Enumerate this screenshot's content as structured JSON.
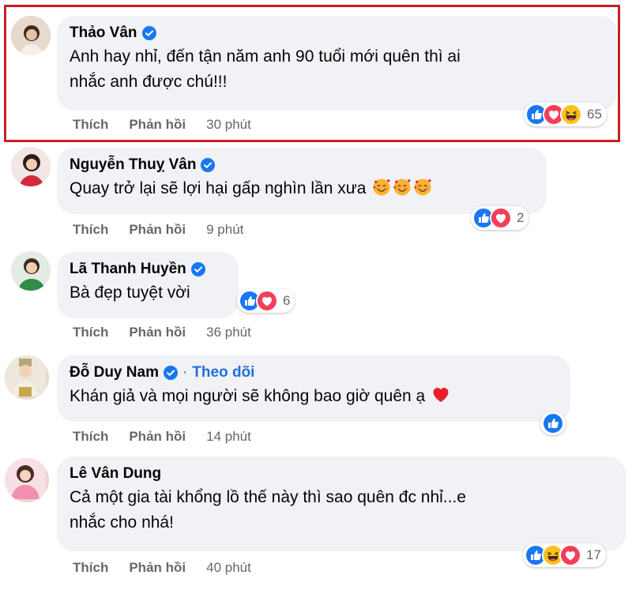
{
  "comments": [
    {
      "name": "Thảo Vân",
      "verified": true,
      "text_lines": [
        "Anh hay nhỉ, đến tận năm anh 90 tuổi mới quên thì ai",
        "nhắc anh được chú!!!"
      ],
      "reactions": [
        "like-icon",
        "love-icon",
        "haha-icon"
      ],
      "reaction_count": "65",
      "like_label": "Thích",
      "reply_label": "Phản hồi",
      "time": "30 phút",
      "highlighted": true
    },
    {
      "name": "Nguyễn Thuỵ Vân",
      "verified": true,
      "text": "Quay trở lại sẽ lợi hại gấp nghìn lần xưa",
      "text_emojis": [
        "smiling-face-with-hearts-icon",
        "smiling-face-with-hearts-icon",
        "smiling-face-with-hearts-icon"
      ],
      "reactions": [
        "like-icon",
        "love-icon"
      ],
      "reaction_count": "2",
      "like_label": "Thích",
      "reply_label": "Phản hồi",
      "time": "9 phút"
    },
    {
      "name": "Lã Thanh Huyền",
      "verified": true,
      "text": "Bà đẹp tuyệt vời",
      "reactions": [
        "like-icon",
        "love-icon"
      ],
      "reaction_count": "6",
      "like_label": "Thích",
      "reply_label": "Phản hồi",
      "time": "36 phút"
    },
    {
      "name": "Đỗ Duy Nam",
      "verified": true,
      "separator": "·",
      "follow_label": "Theo dõi",
      "text": "Khán giả và mọi người sẽ không bao giờ quên ạ",
      "text_emojis": [
        "red-heart-icon"
      ],
      "reactions": [
        "like-icon"
      ],
      "like_label": "Thích",
      "reply_label": "Phản hồi",
      "time": "14 phút"
    },
    {
      "name": "Lê Vân Dung",
      "verified": false,
      "text_lines": [
        "Cả một gia tài khổng lồ thế này thì sao quên đc nhỉ...e",
        "nhắc cho nhá!"
      ],
      "reactions": [
        "like-icon",
        "haha-icon",
        "love-icon"
      ],
      "reaction_count": "17",
      "like_label": "Thích",
      "reply_label": "Phản hồi",
      "time": "40 phút"
    }
  ],
  "colors": {
    "highlight_border": "#c81d25",
    "bubble_bg": "#f0f2f5",
    "like_blue": "#1877f2",
    "love_red": "#f33e58",
    "haha_yellow": "#fcc21b",
    "meta_gray": "#65676b",
    "follow_blue": "#216fdb"
  }
}
